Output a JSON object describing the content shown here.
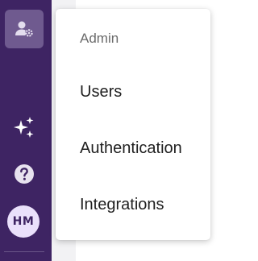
{
  "sidebar": {
    "admin_icon": "person-gear-icon",
    "ai_icon": "sparkles-icon",
    "help_icon": "help-circle-icon",
    "avatar_initials": "HM",
    "colors": {
      "background": "#3e2463",
      "active_item": "#6f5a8f",
      "icon": "#ffffff",
      "avatar_bg": "#eae0fb"
    }
  },
  "menu": {
    "header": "Admin",
    "items": [
      {
        "label": "Users"
      },
      {
        "label": "Authentication"
      },
      {
        "label": "Integrations"
      }
    ]
  }
}
